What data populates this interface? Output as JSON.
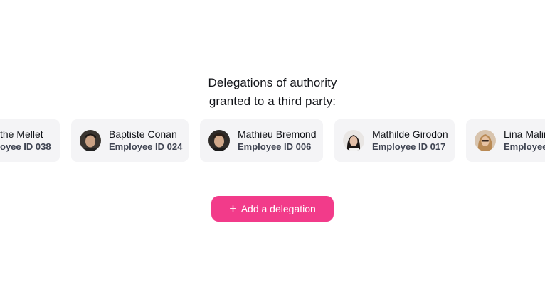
{
  "heading": {
    "line1": "Delegations of authority",
    "line2": "granted to a third party:"
  },
  "delegates": [
    {
      "name": "the Mellet",
      "employee_id": "oyee ID 038",
      "avatar": "none"
    },
    {
      "name": "Baptiste Conan",
      "employee_id": "Employee ID 024",
      "avatar": "man-dark-hair"
    },
    {
      "name": "Mathieu Bremond",
      "employee_id": "Employee ID 006",
      "avatar": "man-portrait"
    },
    {
      "name": "Mathilde Girodon",
      "employee_id": "Employee ID 017",
      "avatar": "woman-dark-hair"
    },
    {
      "name": "Lina Malin",
      "employee_id": "Employee",
      "avatar": "woman-blonde"
    }
  ],
  "add_button": {
    "label": "Add a delegation",
    "icon": "plus-icon",
    "color": "#f23b8a"
  }
}
